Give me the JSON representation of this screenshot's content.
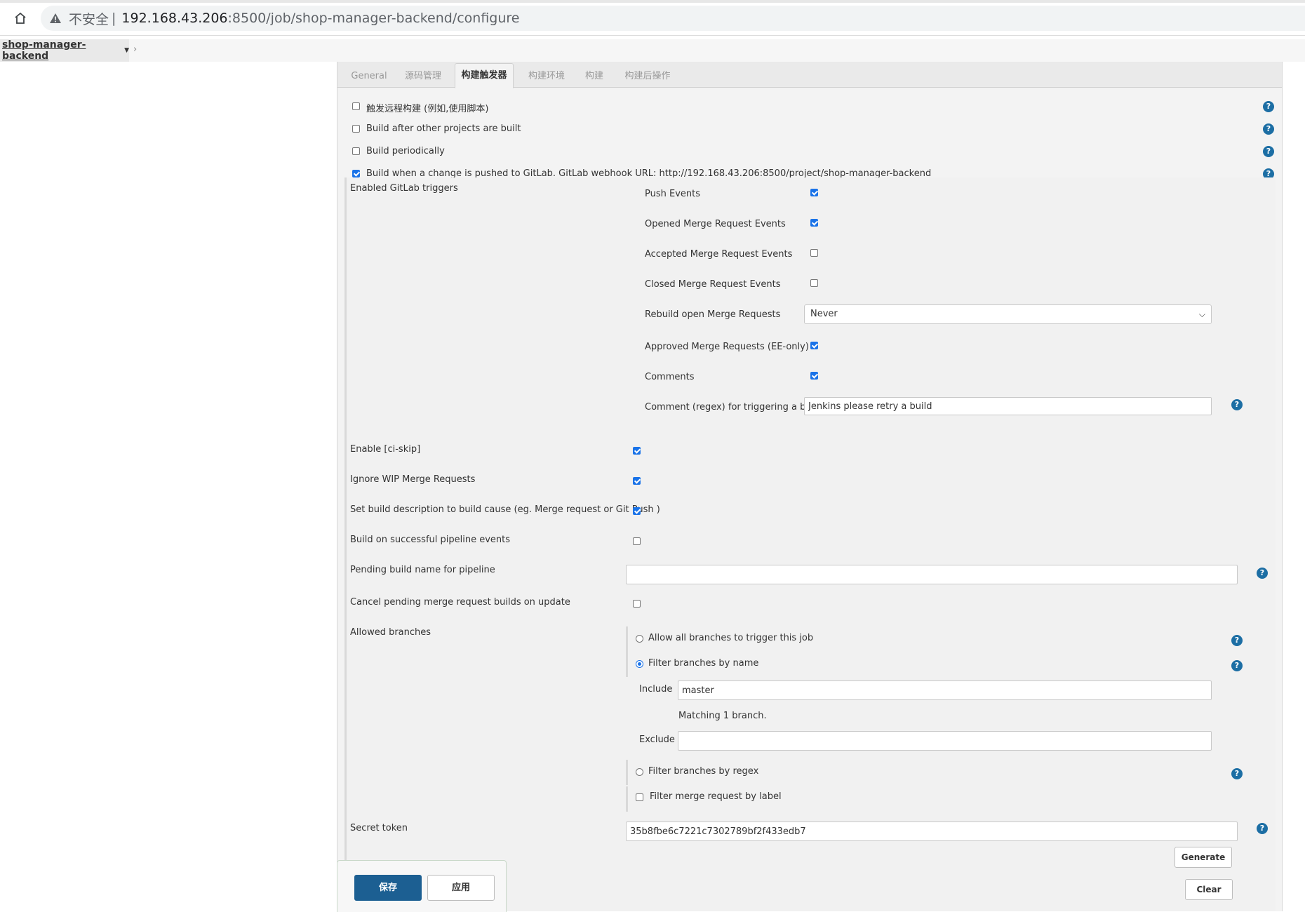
{
  "browser": {
    "insecure_label": "不安全",
    "separator": "|",
    "url_host": "192.168.43.206",
    "url_rest": ":8500/job/shop-manager-backend/configure"
  },
  "breadcrumb": {
    "job_name": "shop-manager-backend"
  },
  "tabs": [
    "General",
    "源码管理",
    "构建触发器",
    "构建环境",
    "构建",
    "构建后操作"
  ],
  "triggers": {
    "remote_build": "触发远程构建 (例如,使用脚本)",
    "after_other": "Build after other projects are built",
    "periodically": "Build periodically",
    "gitlab_push": "Build when a change is pushed to GitLab. GitLab webhook URL: http://192.168.43.206:8500/project/shop-manager-backend"
  },
  "gitlab": {
    "enabled_triggers_label": "Enabled GitLab triggers",
    "push_events": "Push Events",
    "opened_mr_events": "Opened Merge Request Events",
    "accepted_mr_events": "Accepted Merge Request Events",
    "closed_mr_events": "Closed Merge Request Events",
    "rebuild_open_mr": "Rebuild open Merge Requests",
    "rebuild_open_mr_value": "Never",
    "approved_mr": "Approved Merge Requests (EE-only)",
    "comments": "Comments",
    "comment_regex_label": "Comment (regex) for triggering a build",
    "comment_regex_value": "Jenkins please retry a build",
    "enable_ci_skip": "Enable [ci-skip]",
    "ignore_wip": "Ignore WIP Merge Requests",
    "set_build_desc": "Set build description to build cause (eg. Merge request or Git Push )",
    "build_on_pipeline": "Build on successful pipeline events",
    "pending_build_name": "Pending build name for pipeline",
    "pending_build_name_value": "",
    "cancel_pending": "Cancel pending merge request builds on update",
    "allowed_branches": "Allowed branches",
    "allow_all_branches": "Allow all branches to trigger this job",
    "filter_by_name": "Filter branches by name",
    "include_label": "Include",
    "include_value": "master",
    "matching_text": "Matching 1 branch.",
    "exclude_label": "Exclude",
    "exclude_value": "",
    "filter_by_regex": "Filter branches by regex",
    "filter_by_label": "Filter merge request by label",
    "secret_token_label": "Secret token",
    "secret_token_value": "35b8fbe6c7221c7302789bf2f433edb7",
    "generate_button": "Generate",
    "clear_button": "Clear"
  },
  "footer": {
    "save_label": "保存",
    "apply_label": "应用"
  },
  "colors": {
    "accent": "#1a73e8",
    "help_icon": "#1c6ea4",
    "save_button": "#1c5f92"
  },
  "icons": [
    "home-icon",
    "warning-icon",
    "chevron-down-icon",
    "help-icon"
  ]
}
